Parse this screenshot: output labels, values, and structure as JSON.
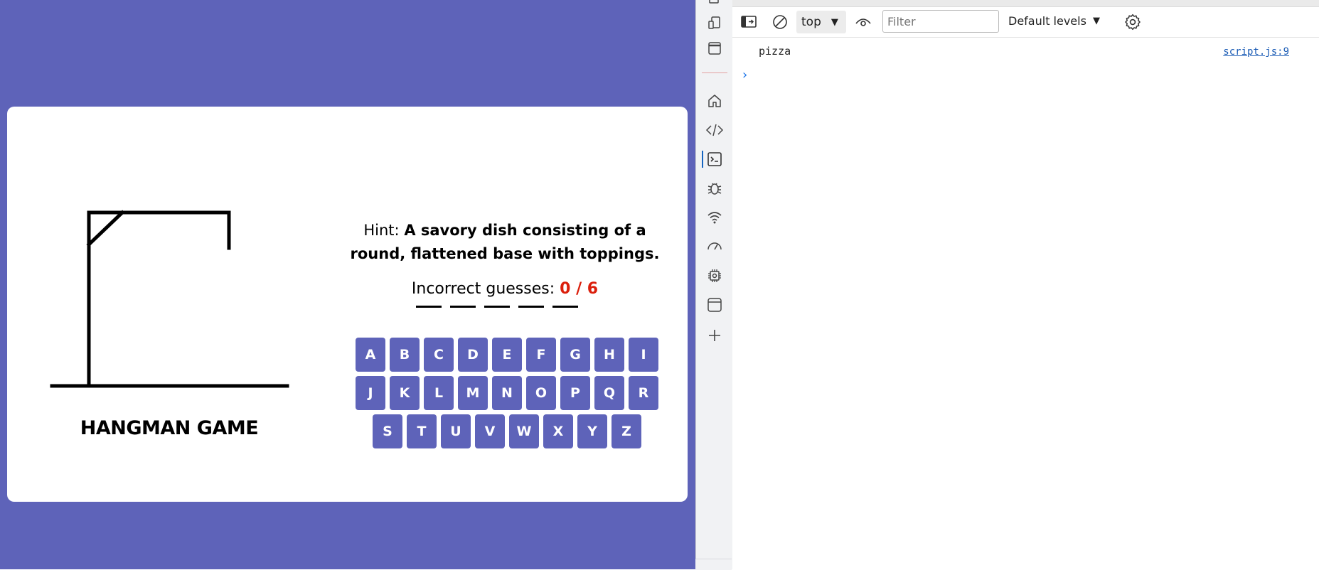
{
  "game": {
    "title": "HANGMAN GAME",
    "word_slots": [
      "",
      "",
      "",
      "",
      ""
    ],
    "hint_label": "Hint:",
    "hint_text": "A savory dish consisting of a round, flattened base with toppings.",
    "guesses_label": "Incorrect guesses:",
    "guesses_count": "0 / 6",
    "keys": [
      "A",
      "B",
      "C",
      "D",
      "E",
      "F",
      "G",
      "H",
      "I",
      "J",
      "K",
      "L",
      "M",
      "N",
      "O",
      "P",
      "Q",
      "R",
      "S",
      "T",
      "U",
      "V",
      "W",
      "X",
      "Y",
      "Z"
    ],
    "colors": {
      "background": "#5e63b9",
      "key": "#5e63b9",
      "guess_count": "#db1f0c"
    }
  },
  "devtools": {
    "sidebar_icons": [
      "inspect-icon",
      "device-toolbar-icon",
      "dock-icon",
      "home-icon",
      "elements-icon",
      "console-icon",
      "bug-icon",
      "network-icon",
      "performance-icon",
      "memory-icon",
      "application-icon",
      "add-tool-icon"
    ],
    "toolbar": {
      "context": "top",
      "filter_placeholder": "Filter",
      "levels": "Default levels"
    },
    "console": {
      "log_text": "pizza",
      "log_source": "script.js:9"
    }
  }
}
